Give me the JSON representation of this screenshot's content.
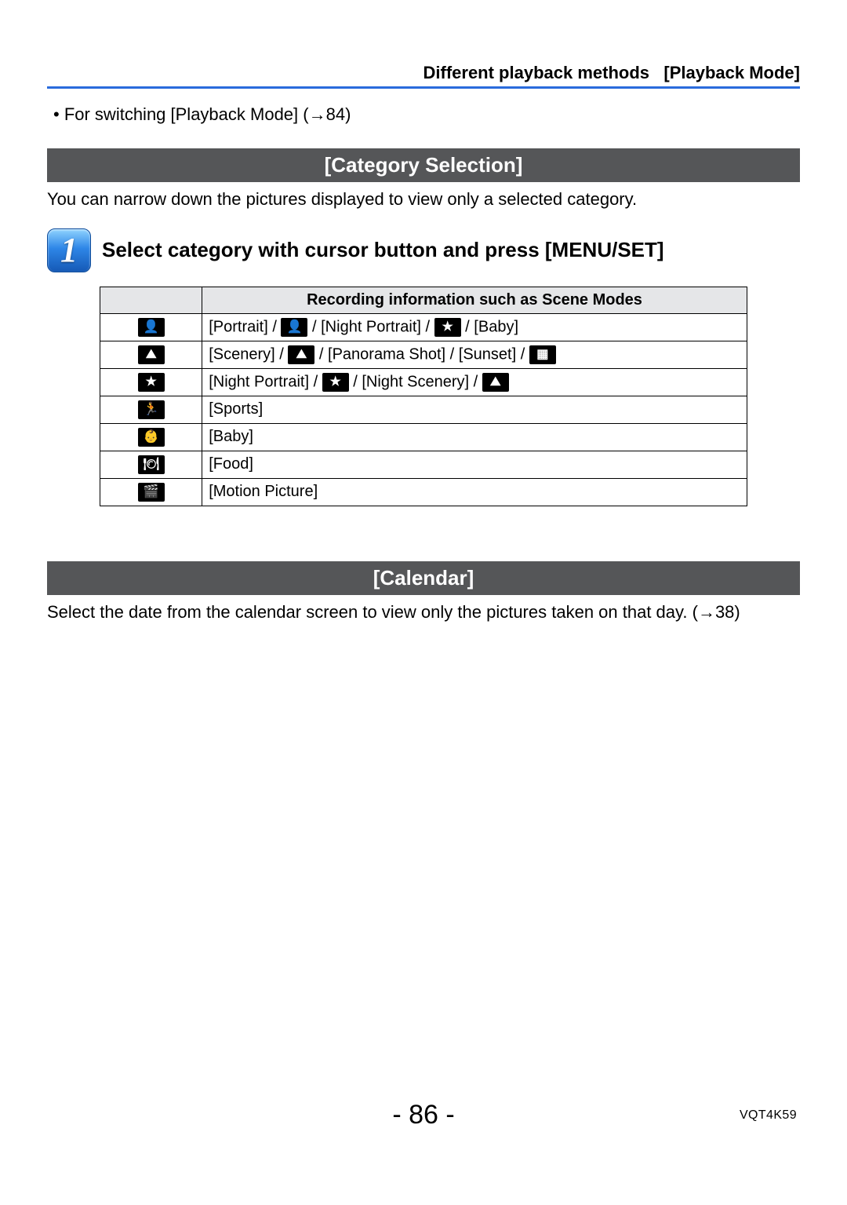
{
  "header": {
    "title_left": "Different playback methods",
    "title_right": "[Playback Mode]"
  },
  "intro": {
    "switch_line": "• For switching [Playback Mode] (→84)"
  },
  "section_category": {
    "bar": "[Category Selection]",
    "desc": "You can narrow down the pictures displayed to view only a selected category."
  },
  "step1": {
    "number": "1",
    "title": "Select category with cursor button and press [MENU/SET]"
  },
  "table": {
    "header_icon": "",
    "header_text": "Recording information such as Scene Modes",
    "rows": [
      {
        "icon_glyph": "👤",
        "icon_name": "portrait-icon",
        "parts": [
          "[Portrait] / ",
          " / [Night Portrait] / ",
          " / [Baby]"
        ],
        "inline_icons": [
          {
            "glyph": "👤",
            "name": "portrait-glow-icon"
          },
          {
            "glyph": "★",
            "name": "star-portrait-icon"
          }
        ]
      },
      {
        "icon_glyph": "⛰",
        "icon_name": "scenery-icon",
        "parts": [
          "[Scenery] / ",
          " / [Panorama Shot] / [Sunset] / ",
          ""
        ],
        "inline_icons": [
          {
            "glyph": "⛰",
            "name": "scenery-inline-icon"
          },
          {
            "glyph": "▦",
            "name": "glass-icon"
          }
        ]
      },
      {
        "icon_glyph": "★",
        "icon_name": "night-portrait-icon",
        "parts": [
          "[Night Portrait] / ",
          " / [Night Scenery] / ",
          ""
        ],
        "inline_icons": [
          {
            "glyph": "★",
            "name": "night-portrait-inline-icon"
          },
          {
            "glyph": "⛰",
            "name": "night-scenery-icon"
          }
        ]
      },
      {
        "icon_glyph": "🏃",
        "icon_name": "sports-icon",
        "parts": [
          "[Sports]"
        ],
        "inline_icons": []
      },
      {
        "icon_glyph": "👶",
        "icon_name": "baby-icon",
        "parts": [
          "[Baby]"
        ],
        "inline_icons": []
      },
      {
        "icon_glyph": "🍽",
        "icon_name": "food-icon",
        "parts": [
          "[Food]"
        ],
        "inline_icons": []
      },
      {
        "icon_glyph": "🎬",
        "icon_name": "motion-picture-icon",
        "parts": [
          "[Motion Picture]"
        ],
        "inline_icons": []
      }
    ]
  },
  "section_calendar": {
    "bar": "[Calendar]",
    "desc": "Select the date from the calendar screen to view only the pictures taken on that day. (→38)"
  },
  "footer": {
    "page_number": "- 86 -",
    "doc_id": "VQT4K59"
  }
}
